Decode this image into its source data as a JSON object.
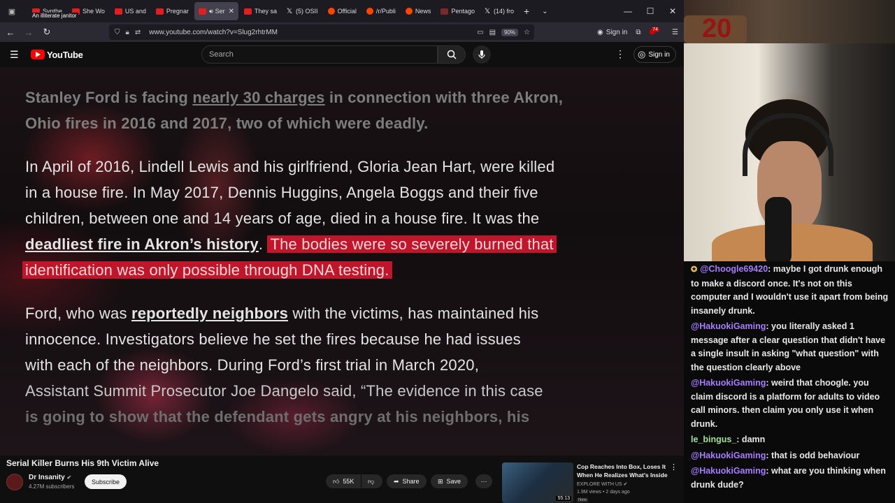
{
  "browser": {
    "tab_tooltip": "An illiterate janitor",
    "tabs": [
      {
        "label": "Synthe",
        "fav": "yt"
      },
      {
        "label": "She Wo",
        "fav": "yt"
      },
      {
        "label": "US and",
        "fav": "yt"
      },
      {
        "label": "Pregnar",
        "fav": "yt"
      },
      {
        "label": "Ser",
        "fav": "yt",
        "active": true
      },
      {
        "label": "They sa",
        "fav": "yt"
      },
      {
        "label": "(5) OSII",
        "fav": "x"
      },
      {
        "label": "Official",
        "fav": "reddit"
      },
      {
        "label": "/r/Publi",
        "fav": "reddit"
      },
      {
        "label": "News",
        "fav": "reddit"
      },
      {
        "label": "Pentago",
        "fav": "other"
      },
      {
        "label": "(14) fro",
        "fav": "x"
      }
    ],
    "url": "www.youtube.com/watch?v=Slug2rhtrMM",
    "zoom": "90%",
    "signin": "Sign in",
    "extension_badge": "74"
  },
  "youtube": {
    "logo": "YouTube",
    "search_placeholder": "Search",
    "signin": "Sign in"
  },
  "video": {
    "p1_a": "Stanley Ford is facing ",
    "p1_link": "nearly 30 charges",
    "p1_b": " in connection with three Akron,",
    "p1_c": "Ohio fires in 2016 and 2017, two of which were deadly.",
    "p2_l1": "In April of 2016, Lindell Lewis and his girlfriend, Gloria Jean Hart, were killed",
    "p2_l2": "in a house fire. In May 2017, Dennis Huggins, Angela Boggs and their five",
    "p2_l3": "children, between one and 14 years of age, died in a house fire. It was the",
    "p2_link": "deadliest fire in Akron’s history",
    "p2_dot": ".",
    "p2_hl1": "The bodies were so severely burned that",
    "p2_hl2": "identification was only possible through DNA testing.",
    "p3_a": "Ford, who was ",
    "p3_link": "reportedly neighbors",
    "p3_b": " with the victims, has maintained his",
    "p3_l2": "innocence. Investigators believe he set the fires because he had issues",
    "p3_l3": "with each of the neighbors. During Ford’s first trial in March 2020,",
    "p3_l4": "Assistant Summit Prosecutor Joe Dangelo said, “The evidence in this case",
    "p3_l5": "is going to show that the defendant gets angry at his neighbors, his"
  },
  "watch": {
    "title": "Serial Killer Burns His 9th Victim Alive",
    "channel": "Dr Insanity",
    "subscribers": "4.27M subscribers",
    "subscribe": "Subscribe",
    "likes": "55K",
    "share": "Share",
    "save": "Save"
  },
  "recommended": {
    "title": "Cop Reaches Into Box, Loses It When He Realizes What's Inside",
    "channel": "EXPLORE WITH US",
    "meta": "1.9M views • 2 days ago",
    "badge": "New",
    "duration": "55:13"
  },
  "overlay": {
    "top_text": "20"
  },
  "chat": [
    {
      "user": "@Choogle69420",
      "text": ": maybe I got drunk enough to make a discord once. It's not on this computer and I wouldn't use it apart from being insanely drunk.",
      "color": "#a77cff",
      "star": true
    },
    {
      "user": "@HakuokiGaming",
      "text": ": you literally asked 1 message after a clear question that didn't have a single insult in asking \"what question\" with the question clearly above",
      "color": "#a77cff"
    },
    {
      "user": "@HakuokiGaming",
      "text": ": weird that choogle. you claim discord is a platform for adults to video call minors. then claim you only use it when drunk.",
      "color": "#a77cff"
    },
    {
      "user": "le_bingus_",
      "text": ": damn",
      "color": "#a0e09a"
    },
    {
      "user": "@HakuokiGaming",
      "text": ": that is odd behaviour",
      "color": "#a77cff"
    },
    {
      "user": "@HakuokiGaming",
      "text": ": what are you thinking when drunk dude?",
      "color": "#a77cff"
    }
  ]
}
